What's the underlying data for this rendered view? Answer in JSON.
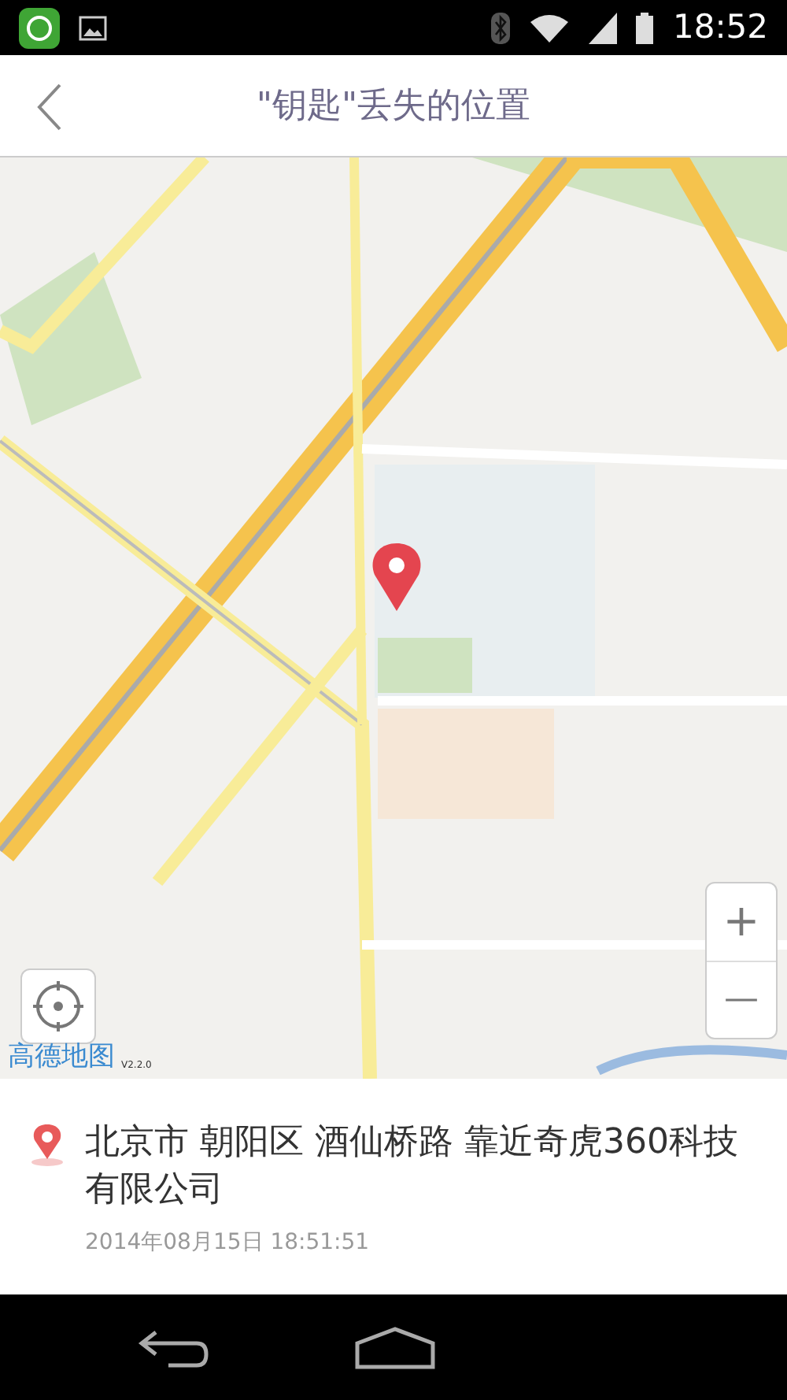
{
  "status_bar": {
    "time": "18:52"
  },
  "header": {
    "title": "\"钥匙\"丢失的位置"
  },
  "map": {
    "logo": "高德地图",
    "version": "V2.2.0",
    "zoom_in": "+",
    "zoom_out": "—"
  },
  "location": {
    "address": "北京市 朝阳区 酒仙桥路 靠近奇虎360科技有限公司",
    "timestamp": "2014年08月15日 18:51:51"
  }
}
